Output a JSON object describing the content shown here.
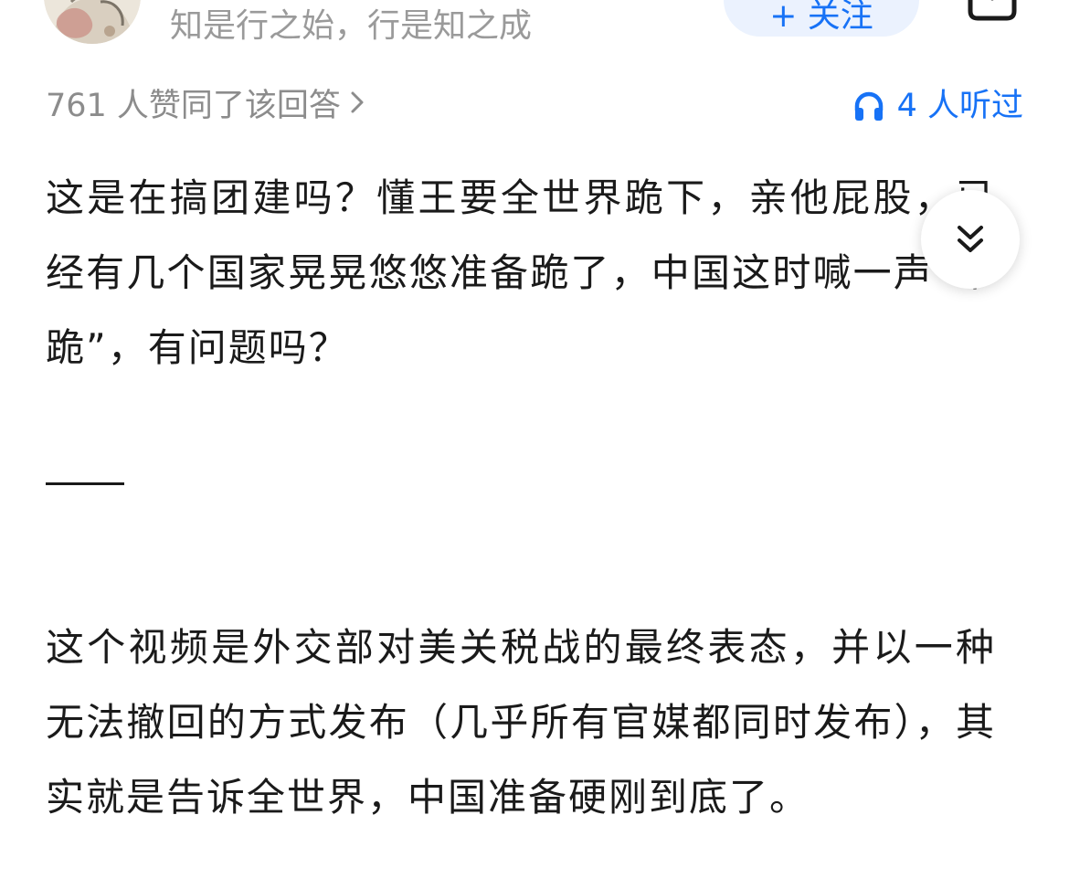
{
  "author": {
    "bio": "知是行之始，行是知之成",
    "follow_label": "+ 关注"
  },
  "meta": {
    "votes_text": "761 人赞同了该回答",
    "listened_text": "4 人听过"
  },
  "answer": {
    "paragraphs": [
      "这是在搞团建吗？懂王要全世界跪下，亲他屁股，已经有几个国家晃晃悠悠准备跪了，中国这时喊一声“不跪”，有问题吗？",
      "这个视频是外交部对美关税战的最终表态，并以一种无法撤回的方式发布（几乎所有官媒都同时发布），其实就是告诉全世界，中国准备硬刚到底了。"
    ]
  },
  "icons": {
    "listen": "headphones-icon",
    "collapse": "double-chevron-down-icon",
    "votes_chevron": "chevron-right-icon",
    "share": "share-icon"
  },
  "colors": {
    "accent": "#1772f6",
    "follow_bg": "#ebf2fe",
    "muted_text": "#8c8c8c",
    "body_text": "#1a1a1a"
  }
}
